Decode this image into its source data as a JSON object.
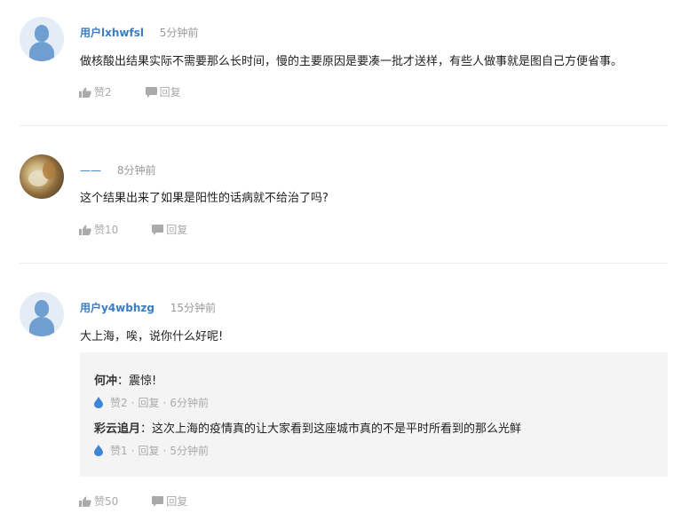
{
  "comments": [
    {
      "username": "用户lxhwfsl",
      "time": "5分钟前",
      "content": "做核酸出结果实际不需要那么长时间，慢的主要原因是要凑一批才送样，有些人做事就是图自己方便省事。",
      "like_label": "赞2",
      "reply_label": "回复",
      "avatar": "default-user-avatar"
    },
    {
      "username": "——",
      "time": "8分钟前",
      "content": "这个结果出来了如果是阳性的话病就不给治了吗?",
      "like_label": "赞10",
      "reply_label": "回复",
      "avatar": "photo-avatar"
    },
    {
      "username": "用户y4wbhzg",
      "time": "15分钟前",
      "content": "大上海，唉，说你什么好呢!",
      "like_label": "赞50",
      "reply_label": "回复",
      "avatar": "default-user-avatar",
      "replies": [
        {
          "username": "何冲",
          "separator": "：",
          "content": "震惊!",
          "like_label": "赞2",
          "reply_label": "回复",
          "time": "6分钟前"
        },
        {
          "username": "彩云追月",
          "separator": "：",
          "content": "这次上海的疫情真的让大家看到这座城市真的不是平时所看到的那么光鲜",
          "like_label": "赞1",
          "reply_label": "回复",
          "time": "5分钟前"
        }
      ]
    }
  ],
  "colors": {
    "username": "#3b7dc4",
    "muted": "#aaaaaa",
    "reply_bg": "#f4f4f4",
    "drop_icon": "#3b86d6"
  }
}
